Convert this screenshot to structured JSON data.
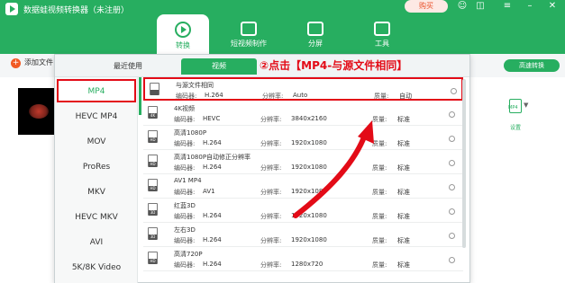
{
  "window": {
    "title": "数据蛙视频转换器（未注册）",
    "buy_label": "购买",
    "controls": [
      "user-icon",
      "gift-icon",
      "menu-icon",
      "minimize-icon",
      "close-icon"
    ]
  },
  "nav": {
    "tabs": [
      {
        "label": "转换",
        "icon": "convert-icon",
        "active": true
      },
      {
        "label": "短视频制作",
        "icon": "film-icon",
        "active": false
      },
      {
        "label": "分屏",
        "icon": "split-screen-icon",
        "active": false
      },
      {
        "label": "工具",
        "icon": "toolbox-icon",
        "active": false
      }
    ]
  },
  "toolbar": {
    "add_label": "添加文件",
    "speed_label": "高速转换"
  },
  "file_row": {
    "set_label": "设置",
    "format_badge": "MP4"
  },
  "dropdown": {
    "tabs": [
      {
        "label": "最近使用",
        "active": false
      },
      {
        "label": "视频",
        "active": true
      }
    ],
    "annotation": "②点击【MP4-与源文件相同】",
    "formats": [
      {
        "label": "MP4",
        "selected": true
      },
      {
        "label": "HEVC MP4",
        "selected": false
      },
      {
        "label": "MOV",
        "selected": false
      },
      {
        "label": "ProRes",
        "selected": false
      },
      {
        "label": "MKV",
        "selected": false
      },
      {
        "label": "HEVC MKV",
        "selected": false
      },
      {
        "label": "AVI",
        "selected": false
      },
      {
        "label": "5K/8K Video",
        "selected": false
      }
    ],
    "field_labels": {
      "encoder": "编码器:",
      "resolution": "分辨率:",
      "quality": "质量:"
    },
    "presets": [
      {
        "name": "与源文件相同",
        "icon_text": "",
        "encoder": "H.264",
        "resolution": "Auto",
        "quality": "自动",
        "selected": true
      },
      {
        "name": "4K视频",
        "icon_text": "4K",
        "encoder": "HEVC",
        "resolution": "3840x2160",
        "quality": "标准",
        "selected": false
      },
      {
        "name": "高清1080P",
        "icon_text": "HD",
        "encoder": "H.264",
        "resolution": "1920x1080",
        "quality": "标准",
        "selected": false
      },
      {
        "name": "高清1080P自动修正分辨率",
        "icon_text": "HD",
        "encoder": "H.264",
        "resolution": "1920x1080",
        "quality": "标准",
        "selected": false
      },
      {
        "name": "AV1 MP4",
        "icon_text": "HD",
        "encoder": "AV1",
        "resolution": "1920x1080",
        "quality": "标准",
        "selected": false
      },
      {
        "name": "红蓝3D",
        "icon_text": "3D",
        "encoder": "H.264",
        "resolution": "1920x1080",
        "quality": "标准",
        "selected": false
      },
      {
        "name": "左右3D",
        "icon_text": "3D",
        "encoder": "H.264",
        "resolution": "1920x1080",
        "quality": "标准",
        "selected": false
      },
      {
        "name": "高清720P",
        "icon_text": "HD",
        "encoder": "H.264",
        "resolution": "1280x720",
        "quality": "标准",
        "selected": false
      }
    ]
  },
  "colors": {
    "brand": "#27ae60",
    "highlight": "#e30b17",
    "add_icon": "#f15a24"
  }
}
